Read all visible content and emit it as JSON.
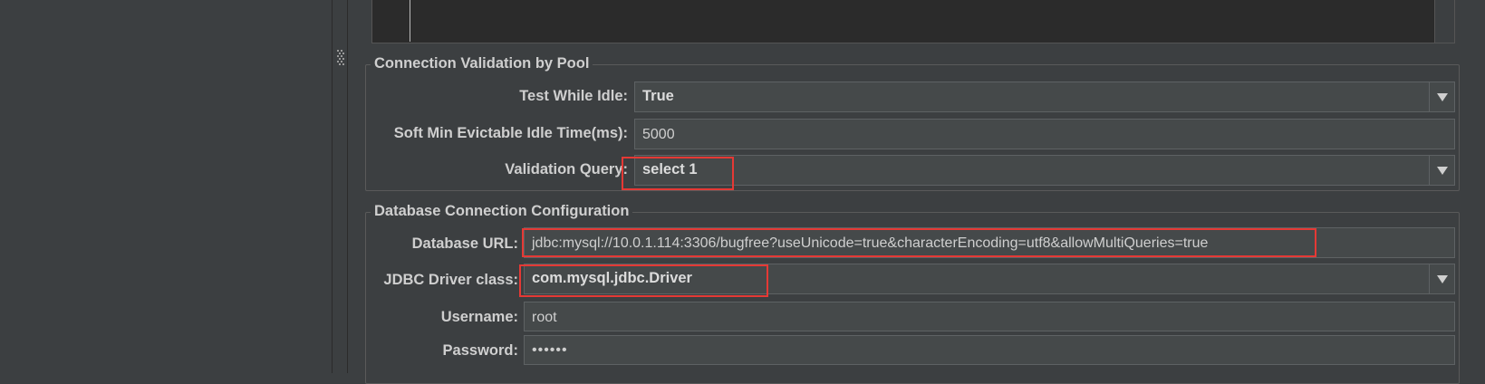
{
  "connection_validation": {
    "legend": "Connection Validation by Pool",
    "test_while_idle": {
      "label": "Test While Idle:",
      "value": "True"
    },
    "soft_min_evictable": {
      "label": "Soft Min Evictable Idle Time(ms):",
      "value": "5000"
    },
    "validation_query": {
      "label": "Validation Query:",
      "value": "select 1"
    }
  },
  "database_connection": {
    "legend": "Database Connection Configuration",
    "database_url": {
      "label": "Database URL:",
      "value": "jdbc:mysql://10.0.1.114:3306/bugfree?useUnicode=true&characterEncoding=utf8&allowMultiQueries=true"
    },
    "jdbc_driver": {
      "label": "JDBC Driver class:",
      "value": "com.mysql.jdbc.Driver"
    },
    "username": {
      "label": "Username:",
      "value": "root"
    },
    "password": {
      "label": "Password:",
      "value": "••••••"
    }
  },
  "icons": {
    "dropdown": "chevron-down-icon",
    "splitter": "grip-icon"
  },
  "colors": {
    "background": "#3c3f41",
    "field": "#45494a",
    "text_area": "#2b2b2b",
    "highlight": "#e53935"
  }
}
